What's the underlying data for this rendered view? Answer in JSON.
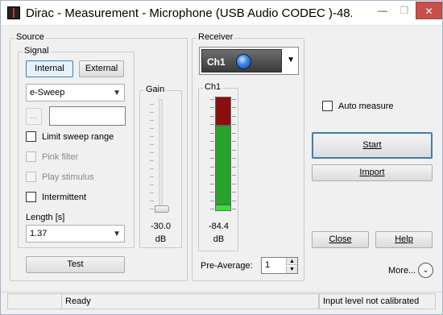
{
  "window": {
    "title": "Dirac - Measurement - Microphone (USB Audio CODEC )-48...",
    "min_symbol": "—",
    "max_symbol": "❐",
    "close_symbol": "✕"
  },
  "source": {
    "group_label": "Source",
    "signal_label": "Signal",
    "internal_label": "Internal",
    "external_label": "External",
    "signal_type": "e-Sweep",
    "browse_label": "...",
    "file_value": "",
    "limit_sweep_label": "Limit sweep range",
    "pink_filter_label": "Pink filter",
    "play_stimulus_label": "Play stimulus",
    "intermittent_label": "Intermittent",
    "length_label": "Length [s]",
    "length_value": "1.37",
    "test_label": "Test"
  },
  "gain": {
    "label": "Gain",
    "value": "-30.0",
    "unit": "dB",
    "level": 0.0
  },
  "receiver": {
    "group_label": "Receiver",
    "channel_selected": "Ch1",
    "meter_label": "Ch1",
    "level_value": "-84.4",
    "level_unit": "dB",
    "pre_average_label": "Pre-Average:",
    "pre_average_value": "1"
  },
  "actions": {
    "auto_measure_label": "Auto measure",
    "start_label": "Start",
    "import_label": "Import",
    "close_label": "Close",
    "help_label": "Help",
    "more_label": "More..."
  },
  "status": {
    "pane1": "",
    "state": "Ready",
    "calibration": "Input level not calibrated"
  },
  "colors": {
    "accent": "#3c7fb1",
    "meter_red": "#8b0f0f",
    "meter_green": "#29a32b",
    "meter_bright_green": "#33e633"
  }
}
